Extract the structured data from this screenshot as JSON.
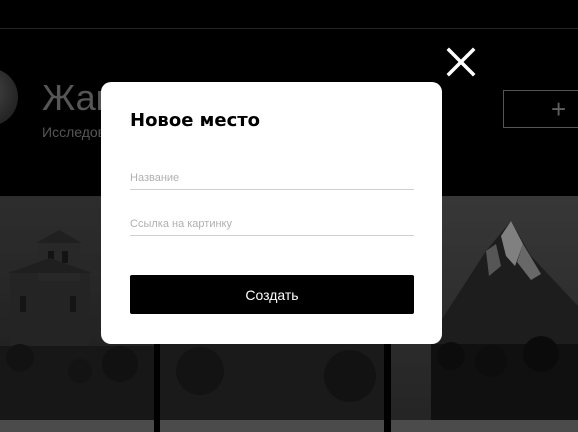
{
  "profile": {
    "name": "Жак-Ив Кусто",
    "about": "Исследователь океана"
  },
  "profile_actions": {
    "add_label": "+"
  },
  "modal": {
    "title": "Новое место",
    "name_placeholder": "Название",
    "link_placeholder": "Ссылка на картинку",
    "submit_label": "Создать"
  },
  "icons": {
    "close": "close-icon",
    "add": "plus-icon"
  },
  "colors": {
    "page_background": "#000000",
    "modal_background": "#ffffff",
    "submit_background": "#000000",
    "muted_text": "#8b8b8b"
  }
}
